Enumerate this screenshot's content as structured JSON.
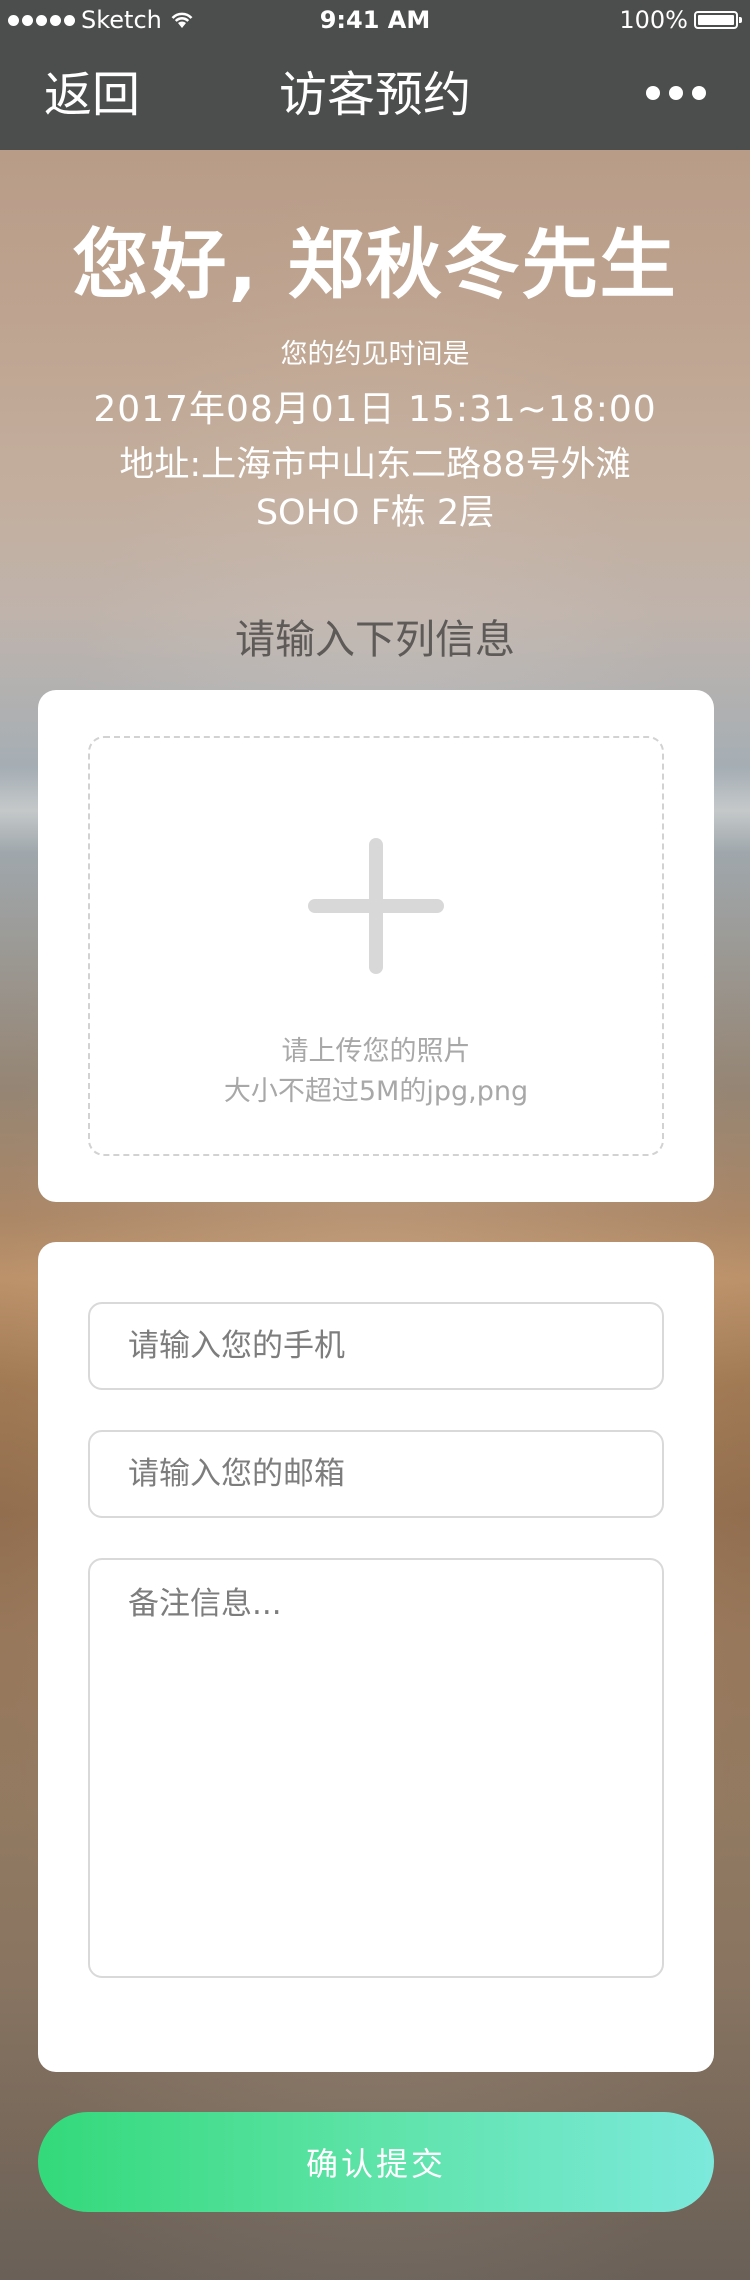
{
  "status_bar": {
    "carrier": "Sketch",
    "time": "9:41 AM",
    "battery": "100%"
  },
  "nav": {
    "back_label": "返回",
    "title": "访客预约",
    "more_icon": "more-horizontal-icon"
  },
  "greeting": {
    "headline": "您好, 郑秋冬先生",
    "subtitle": "您的约见时间是",
    "time": "2017年08月01日 15:31~18:00",
    "address_line1": "地址:上海市中山东二路88号外滩",
    "address_line2": "SOHO F栋 2层"
  },
  "form_title": "请输入下列信息",
  "upload": {
    "icon": "plus-icon",
    "hint_line1": "请上传您的照片",
    "hint_line2": "大小不超过5M的jpg,png"
  },
  "fields": {
    "phone_placeholder": "请输入您的手机",
    "email_placeholder": "请输入您的邮箱",
    "note_placeholder": "备注信息..."
  },
  "submit_label": "确认提交",
  "colors": {
    "nav_bg": "#4c4e4d",
    "button_gradient_start": "#33d97a",
    "button_gradient_end": "#7ce9dc"
  }
}
